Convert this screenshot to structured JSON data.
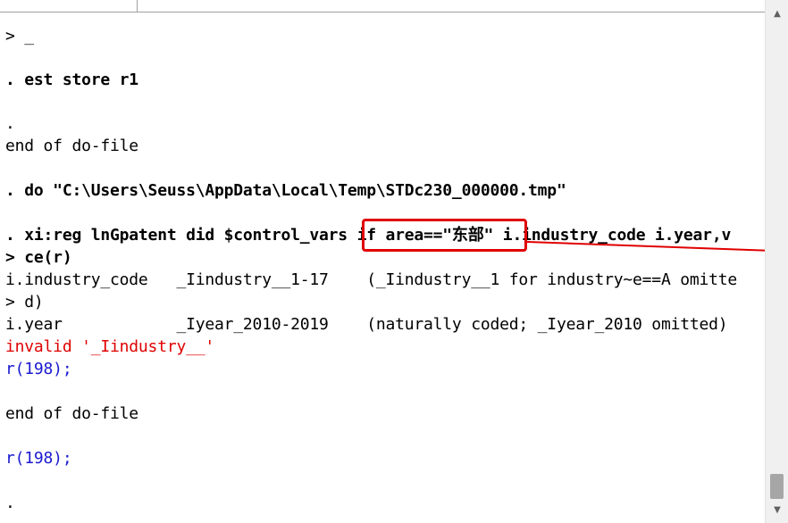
{
  "console": {
    "lines": [
      "> _",
      ". est store r1",
      ".",
      "end of do-file",
      ". do \"C:\\Users\\Seuss\\AppData\\Local\\Temp\\STDc230_000000.tmp\"",
      ". xi:reg lnGpatent did $control_vars if area==\"东部\" i.industry_code i.year,v",
      "> ce(r)",
      "i.industry_code   _Iindustry__1-17    (_Iindustry__1 for industry~e==A omitte",
      "> d)",
      "i.year            _Iyear_2010-2019    (naturally coded; _Iyear_2010 omitted)",
      "invalid '_Iindustry__'",
      "r(198);",
      "end of do-file",
      "r(198);",
      "."
    ]
  },
  "highlight": {
    "text": "if area==\"东部\"",
    "color": "#e00000"
  },
  "colors": {
    "error": "#e00000",
    "return_code": "#1a1ad0"
  },
  "scrollbar": {
    "up_icon": "triangle-up",
    "down_icon": "triangle-down"
  }
}
